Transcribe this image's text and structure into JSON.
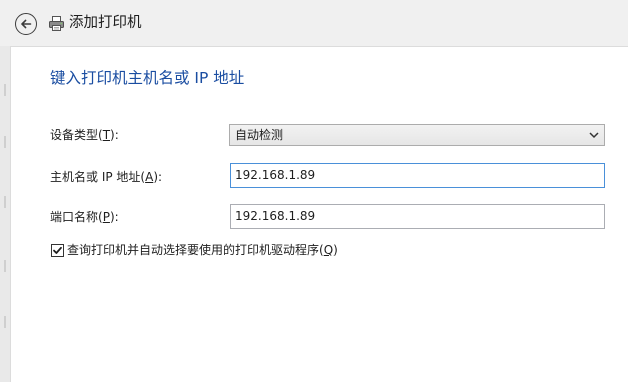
{
  "header": {
    "back_icon": "back-arrow-icon",
    "printer_icon": "printer-icon",
    "title": "添加打印机"
  },
  "main": {
    "heading": "键入打印机主机名或 IP 地址",
    "device_type": {
      "label": "设备类型(T):",
      "access_key": "T",
      "selected": "自动检测"
    },
    "host": {
      "label": "主机名或 IP 地址(A):",
      "access_key": "A",
      "value": "192.168.1.89"
    },
    "port": {
      "label": "端口名称(P):",
      "access_key": "P",
      "value": "192.168.1.89"
    },
    "query_driver": {
      "checked": true,
      "label": "查询打印机并自动选择要使用的打印机驱动程序(Q)",
      "access_key": "Q"
    }
  },
  "colors": {
    "heading": "#1a4da1",
    "focus_border": "#4a90d9"
  }
}
